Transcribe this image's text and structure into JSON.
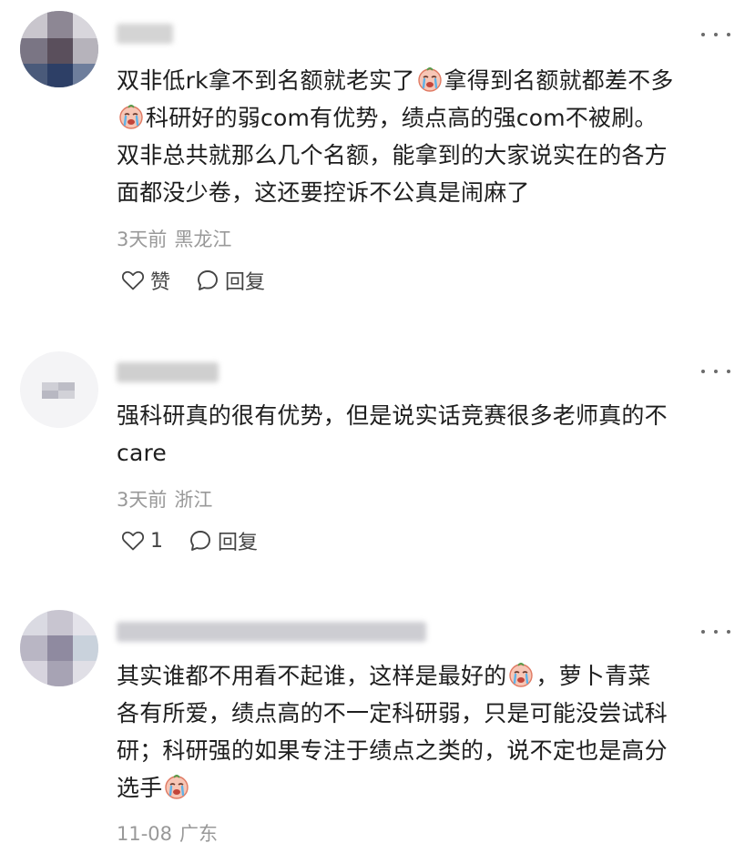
{
  "comments": [
    {
      "username": "",
      "more_icon": "more-dots-icon",
      "lines": [
        [
          "双非低rk拿不到名额就老实了",
          "@emoji",
          "拿得到名额就都差不多"
        ],
        [
          "@emoji",
          "科研好的弱com有优势，绩点高的强com不被刷。"
        ],
        [
          "双非总共就那么几个名额，能拿到的大家说实在的各方"
        ],
        [
          "面都没少卷，这还要控诉不公真是闹麻了"
        ]
      ],
      "time": "3天前",
      "location": "黑龙江",
      "like_label": "赞",
      "reply_label": "回复"
    },
    {
      "username": "",
      "more_icon": "more-dots-icon",
      "lines": [
        [
          "强科研真的很有优势，但是说实话竞赛很多老师真的不"
        ],
        [
          "care"
        ]
      ],
      "time": "3天前",
      "location": "浙江",
      "like_label": "1",
      "reply_label": "回复"
    },
    {
      "username": "",
      "more_icon": "more-dots-icon",
      "lines": [
        [
          "其实谁都不用看不起谁，这样是最好的",
          "@emoji",
          "，萝卜青菜"
        ],
        [
          "各有所爱，绩点高的不一定科研弱，只是可能没尝试科"
        ],
        [
          "研；科研强的如果专注于绩点之类的，说不定也是高分"
        ],
        [
          "选手",
          "@emoji"
        ]
      ],
      "time": "11-08",
      "location": "广东"
    }
  ],
  "colors": {
    "meta": "#999999",
    "text": "#1e1e1e",
    "icon": "#444444"
  },
  "icons": {
    "emoji": "crying-face-emoji",
    "like": "heart-outline-icon",
    "reply": "speech-bubble-icon"
  }
}
